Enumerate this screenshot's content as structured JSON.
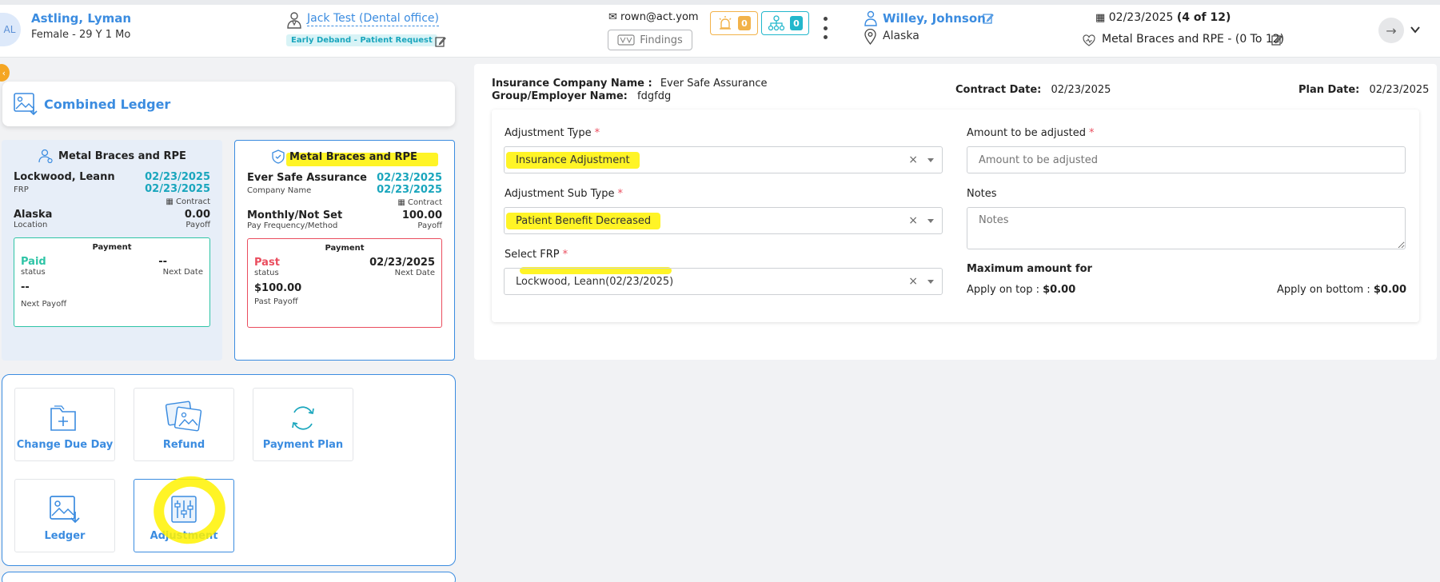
{
  "header": {
    "avatar_initials": "AL",
    "patient_name": "Astling, Lyman",
    "patient_info": "Female - 29 Y 1 Mo",
    "doctor_name": "Jack Test (Dental office)",
    "tag": "Early Deband - Patient Request",
    "email": "rown@act.yom",
    "findings_label": "Findings",
    "alerts_count": "0",
    "network_count": "0",
    "responsible_name": "Willey, Johnson",
    "location": "Alaska",
    "date": "02/23/2025",
    "date_suffix": "(4 of 12)",
    "plan_label": "Metal Braces and RPE - (0 To 12)"
  },
  "sidebar": {
    "collapse_icon": "chevron-left-icon",
    "combined_ledger": "Combined Ledger",
    "frp_card": {
      "title": "Metal Braces and RPE",
      "name": "Lockwood, Leann",
      "date1": "02/23/2025",
      "role": "FRP",
      "date2": "02/23/2025",
      "contract": "Contract",
      "location": "Alaska",
      "location_label": "Location",
      "payoff": "0.00",
      "payoff_label": "Payoff",
      "payment_head": "Payment",
      "status": "Paid",
      "status_label": "status",
      "next_date": "--",
      "next_date_label": "Next Date",
      "next_payoff": "--",
      "next_payoff_label": "Next Payoff"
    },
    "ins_card": {
      "title": "Metal Braces and RPE",
      "company": "Ever Safe Assurance",
      "date1": "02/23/2025",
      "company_label": "Company Name",
      "date2": "02/23/2025",
      "contract": "Contract",
      "freq": "Monthly/Not Set",
      "freq_label": "Pay Frequency/Method",
      "payoff": "100.00",
      "payoff_label": "Payoff",
      "payment_head": "Payment",
      "status": "Past",
      "status_label": "status",
      "next_date": "02/23/2025",
      "next_date_label": "Next Date",
      "past_payoff": "$100.00",
      "past_payoff_label": "Past Payoff"
    },
    "actions": {
      "change_due_day": "Change Due Day",
      "refund": "Refund",
      "payment_plan": "Payment Plan",
      "ledger": "Ledger",
      "adjustment": "Adjustment"
    }
  },
  "main": {
    "insurance_company_label": "Insurance Company Name :",
    "insurance_company_value": "Ever Safe Assurance",
    "group_label": "Group/Employer Name:",
    "group_value": "fdgfdg",
    "contract_date_label": "Contract Date:",
    "contract_date_value": "02/23/2025",
    "plan_date_label": "Plan Date:",
    "plan_date_value": "02/23/2025",
    "form": {
      "adjustment_type_label": "Adjustment Type",
      "adjustment_type_value": "Insurance Adjustment",
      "adjustment_sub_type_label": "Adjustment Sub Type",
      "adjustment_sub_type_value": "Patient Benefit Decreased",
      "select_frp_label": "Select FRP",
      "select_frp_value": "Lockwood, Leann(02/23/2025)",
      "amount_label": "Amount to be adjusted",
      "amount_placeholder": "Amount to be adjusted",
      "notes_label": "Notes",
      "notes_placeholder": "Notes",
      "max_amount_label": "Maximum amount for",
      "apply_top_label": "Apply on top :",
      "apply_top_value": "$0.00",
      "apply_bottom_label": "Apply on bottom :",
      "apply_bottom_value": "$0.00",
      "required_mark": "*"
    }
  },
  "colors": {
    "accent_blue": "#3b8ce0",
    "teal": "#1aa6bd",
    "paid_green": "#2ec4a6",
    "past_red": "#ea4d5e",
    "highlight": "#fff200"
  }
}
